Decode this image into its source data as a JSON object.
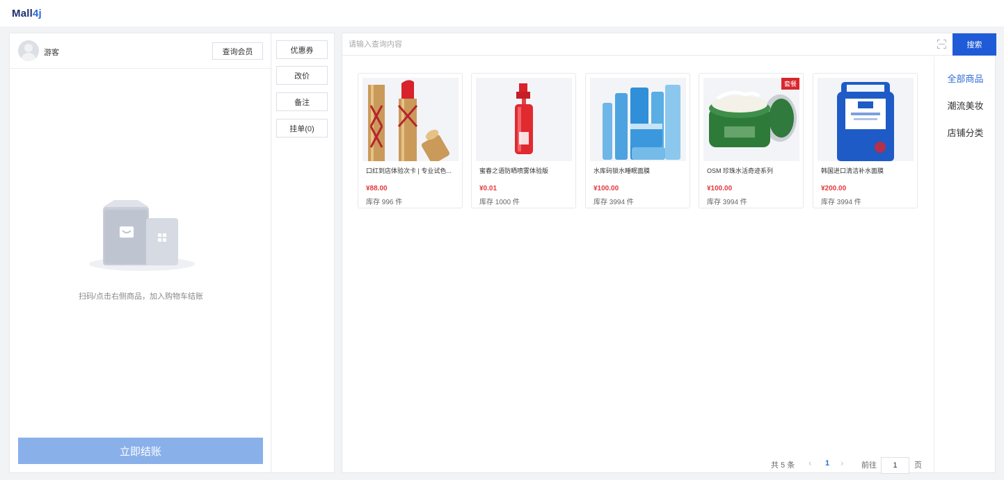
{
  "app": {
    "logo_main": "Mall",
    "logo_accent": "4j"
  },
  "cart": {
    "guest_label": "游客",
    "query_member_label": "查询会员",
    "empty_hint": "扫码/点击右侧商品，加入购物车结账",
    "checkout_label": "立即结账"
  },
  "actions": {
    "coupon_label": "优惠券",
    "change_price_label": "改价",
    "remark_label": "备注",
    "hold_order_label": "挂单(0)"
  },
  "search": {
    "placeholder": "请输入查询内容",
    "button_label": "搜索",
    "scan_icon": "scan-icon"
  },
  "categories": [
    {
      "label": "全部商品",
      "active": true
    },
    {
      "label": "潮流美妆",
      "active": false
    },
    {
      "label": "店铺分类",
      "active": false
    }
  ],
  "products": [
    {
      "name": "口红到店体验次卡 | 专业试色...",
      "price": "¥88.00",
      "stock": "库存 996 件",
      "badge": ""
    },
    {
      "name": "蜜春之语防晒喷雾体验版",
      "price": "¥0.01",
      "stock": "库存 1000 件",
      "badge": ""
    },
    {
      "name": "水库码锁水睡眠面膜",
      "price": "¥100.00",
      "stock": "库存 3994 件",
      "badge": ""
    },
    {
      "name": "OSM 珍珠水活奇迹系列",
      "price": "¥100.00",
      "stock": "库存 3994 件",
      "badge": "套餐"
    },
    {
      "name": "韩国进口清洁补水面膜",
      "price": "¥200.00",
      "stock": "库存 3994 件",
      "badge": ""
    }
  ],
  "pagination": {
    "total_label": "共 5 条",
    "prev_icon": "‹",
    "current_page": "1",
    "next_icon": "›",
    "goto_label": "前往",
    "goto_value": "1",
    "page_suffix": "页"
  },
  "colors": {
    "primary": "#1f5bd6",
    "accent": "#2b6bd6",
    "price": "#e4393c",
    "checkout_disabled": "#8ab0ea",
    "badge": "#d9262c"
  }
}
